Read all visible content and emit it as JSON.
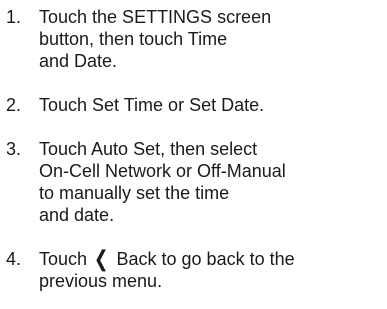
{
  "steps": [
    {
      "number": "1.",
      "lines": [
        "Touch the SETTINGS screen",
        "button, then touch Time",
        "and Date."
      ]
    },
    {
      "number": "2.",
      "lines": [
        "Touch Set Time or Set Date."
      ]
    },
    {
      "number": "3.",
      "lines": [
        "Touch Auto Set, then select",
        "On-Cell Network or Off-Manual",
        "to manually set the time",
        "and date."
      ]
    },
    {
      "number": "4.",
      "line1_before_icon": "Touch",
      "icon": "back-chevron-icon",
      "line1_after_icon": "Back to go back to the",
      "lines_rest": [
        "previous menu."
      ]
    }
  ]
}
